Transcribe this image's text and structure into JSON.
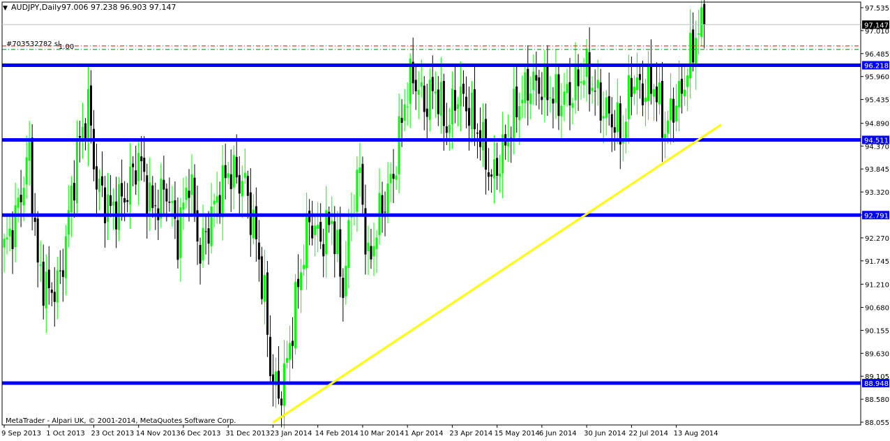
{
  "header": {
    "menu_glyph": "▼",
    "symbol_text": "AUDJPY,Daily",
    "ohlc_text": "97.006 97.238 96.903 97.147"
  },
  "order": {
    "label": "#703532782 sl",
    "value": "1.00"
  },
  "footer": {
    "copyright": "MetaTrader - Alpari UK, © 2001-2014, MetaQuotes Software Corp."
  },
  "colors": {
    "background": "#ffffff",
    "bull_candle": "#00ff00",
    "bear_candle": "#000000",
    "support_resistance": "#0000ff",
    "trendline": "#ffff00",
    "order_line": "#ff0000",
    "axis_text": "#000000"
  },
  "chart_data": {
    "type": "candlestick",
    "symbol": "AUDJPY",
    "timeframe": "Daily",
    "ylim": [
      88.01,
      97.7
    ],
    "y_ticks": [
      "97.535",
      "97.010",
      "96.485",
      "95.960",
      "95.435",
      "94.890",
      "94.370",
      "93.845",
      "93.320",
      "92.795",
      "92.270",
      "91.745",
      "91.210",
      "90.680",
      "90.155",
      "89.630",
      "89.105",
      "88.580",
      "88.055"
    ],
    "x_ticks": [
      "9 Sep 2013",
      "1 Oct 2013",
      "23 Oct 2013",
      "14 Nov 2013",
      "6 Dec 2013",
      "31 Dec 2013",
      "23 Jan 2014",
      "14 Feb 2014",
      "10 Mar 2014",
      "1 Apr 2014",
      "23 Apr 2014",
      "15 May 2014",
      "6 Jun 2014",
      "30 Jun 2014",
      "22 Jul 2014",
      "13 Aug 2014"
    ],
    "x_tick_bar_index": [
      0,
      16,
      32,
      48,
      64,
      80,
      96,
      112,
      128,
      144,
      160,
      176,
      192,
      208,
      224,
      240
    ],
    "current_price": "97.147",
    "levels": [
      {
        "label": "96.218",
        "value": 96.218
      },
      {
        "label": "94.511",
        "value": 94.511
      },
      {
        "label": "92.791",
        "value": 92.791
      },
      {
        "label": "88.948",
        "value": 88.948
      }
    ],
    "order_levels": [
      96.66,
      96.58
    ],
    "trendline": {
      "from": {
        "bar": 96,
        "value": 88.05
      },
      "to": {
        "bar": 256,
        "value": 94.86
      }
    },
    "close_keypoints": [
      [
        0,
        92.0
      ],
      [
        4,
        92.7
      ],
      [
        9,
        94.2
      ],
      [
        12,
        91.6
      ],
      [
        16,
        91.0
      ],
      [
        20,
        91.3
      ],
      [
        26,
        94.2
      ],
      [
        30,
        95.3
      ],
      [
        33,
        93.5
      ],
      [
        38,
        92.9
      ],
      [
        43,
        93.2
      ],
      [
        48,
        94.1
      ],
      [
        53,
        92.9
      ],
      [
        58,
        93.4
      ],
      [
        62,
        92.3
      ],
      [
        66,
        93.7
      ],
      [
        70,
        91.9
      ],
      [
        74,
        92.8
      ],
      [
        80,
        93.8
      ],
      [
        86,
        93.5
      ],
      [
        90,
        92.2
      ],
      [
        93,
        90.9
      ],
      [
        95,
        89.3
      ],
      [
        98,
        88.6
      ],
      [
        101,
        89.4
      ],
      [
        105,
        91.2
      ],
      [
        109,
        92.7
      ],
      [
        113,
        92.2
      ],
      [
        117,
        92.7
      ],
      [
        121,
        91.1
      ],
      [
        124,
        92.9
      ],
      [
        127,
        93.8
      ],
      [
        130,
        91.6
      ],
      [
        134,
        92.8
      ],
      [
        139,
        93.7
      ],
      [
        143,
        95.4
      ],
      [
        146,
        96.0
      ],
      [
        150,
        95.3
      ],
      [
        154,
        95.7
      ],
      [
        158,
        94.8
      ],
      [
        162,
        95.6
      ],
      [
        166,
        95.2
      ],
      [
        170,
        94.6
      ],
      [
        174,
        93.6
      ],
      [
        178,
        94.2
      ],
      [
        183,
        95.3
      ],
      [
        188,
        95.8
      ],
      [
        193,
        95.7
      ],
      [
        198,
        95.4
      ],
      [
        203,
        95.6
      ],
      [
        207,
        96.1
      ],
      [
        210,
        95.8
      ],
      [
        213,
        95.3
      ],
      [
        217,
        95.0
      ],
      [
        221,
        94.6
      ],
      [
        224,
        95.9
      ],
      [
        228,
        95.6
      ],
      [
        232,
        95.8
      ],
      [
        236,
        94.7
      ],
      [
        239,
        95.3
      ],
      [
        242,
        95.6
      ],
      [
        245,
        96.4
      ],
      [
        247,
        96.9
      ],
      [
        250,
        97.15
      ]
    ]
  }
}
